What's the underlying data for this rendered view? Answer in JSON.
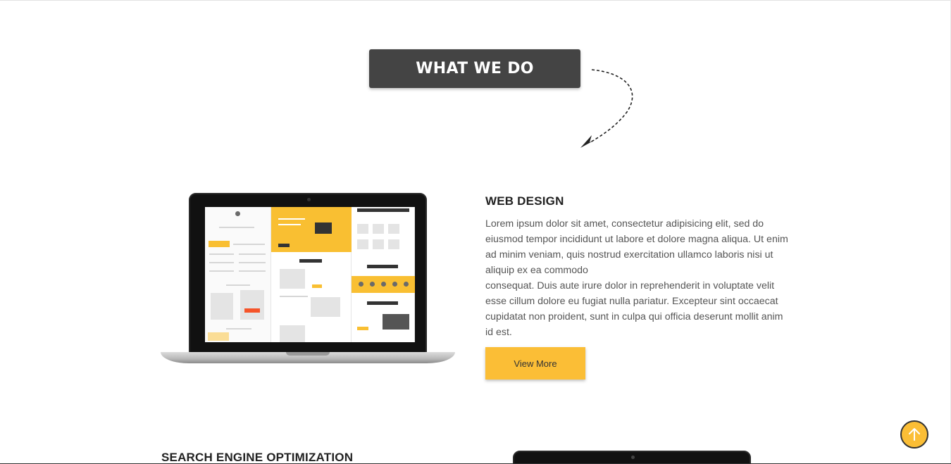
{
  "section": {
    "title": "WHAT WE DO"
  },
  "service": {
    "title": "WEB DESIGN",
    "paragraph1": "Lorem ipsum dolor sit amet, consectetur adipisicing elit, sed do eiusmod tempor incididunt ut labore et dolore magna aliqua. Ut enim ad minim veniam, quis nostrud exercitation ullamco laboris nisi ut aliquip ex ea commodo",
    "paragraph2": "consequat. Duis aute irure dolor in reprehenderit in voluptate velit esse cillum dolore eu fugiat nulla pariatur. Excepteur sint occaecat cupidatat non proident, sunt in culpa qui officia deserunt mollit anim id est.",
    "button_label": "View More"
  },
  "next_service": {
    "title": "SEARCH ENGINE OPTIMIZATION"
  },
  "colors": {
    "accent": "#fbbe36",
    "title_bg": "#444444",
    "text": "#555555"
  },
  "icons": {
    "arrow": "dashed-curved-arrow-icon",
    "scroll_top": "arrow-up-icon"
  }
}
